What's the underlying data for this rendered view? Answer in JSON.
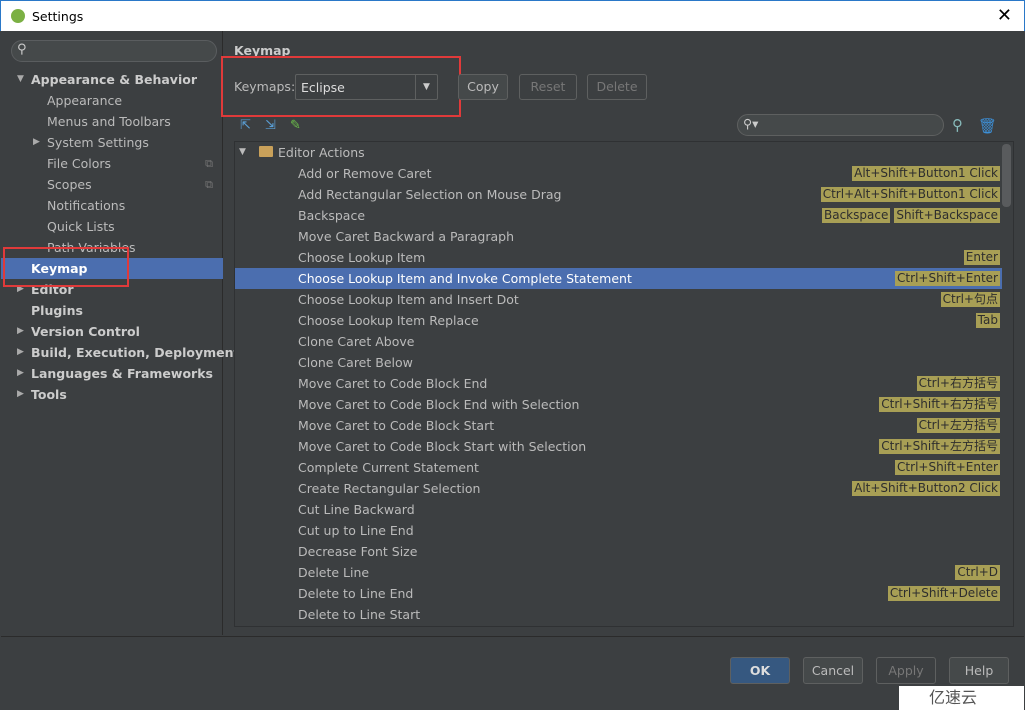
{
  "window": {
    "title": "Settings",
    "close": "✕"
  },
  "sidebar": {
    "search_icon": "search-icon",
    "items": [
      {
        "label": "Appearance & Behavior",
        "level": 0,
        "bold": true,
        "expanded": true
      },
      {
        "label": "Appearance",
        "level": 1
      },
      {
        "label": "Menus and Toolbars",
        "level": 1
      },
      {
        "label": "System Settings",
        "level": 1,
        "collapsed": true
      },
      {
        "label": "File Colors",
        "level": 1,
        "project": true
      },
      {
        "label": "Scopes",
        "level": 1,
        "project": true
      },
      {
        "label": "Notifications",
        "level": 1
      },
      {
        "label": "Quick Lists",
        "level": 1
      },
      {
        "label": "Path Variables",
        "level": 1
      },
      {
        "label": "Keymap",
        "level": 0,
        "bold": true,
        "selected": true
      },
      {
        "label": "Editor",
        "level": 0,
        "bold": true,
        "collapsed": true
      },
      {
        "label": "Plugins",
        "level": 0,
        "bold": true
      },
      {
        "label": "Version Control",
        "level": 0,
        "bold": true,
        "collapsed": true
      },
      {
        "label": "Build, Execution, Deployment",
        "level": 0,
        "bold": true,
        "collapsed": true
      },
      {
        "label": "Languages & Frameworks",
        "level": 0,
        "bold": true,
        "collapsed": true
      },
      {
        "label": "Tools",
        "level": 0,
        "bold": true,
        "collapsed": true
      }
    ]
  },
  "main": {
    "title": "Keymap",
    "keymaps_label": "Keymaps:",
    "keymap_value": "Eclipse",
    "copy": "Copy",
    "reset": "Reset",
    "delete": "Delete",
    "group": "Editor Actions",
    "rows": [
      {
        "label": "Add or Remove Caret",
        "keys": [
          "Alt+Shift+Button1 Click"
        ]
      },
      {
        "label": "Add Rectangular Selection on Mouse Drag",
        "keys": [
          "Ctrl+Alt+Shift+Button1 Click"
        ]
      },
      {
        "label": "Backspace",
        "keys": [
          "Backspace",
          "Shift+Backspace"
        ]
      },
      {
        "label": "Move Caret Backward a Paragraph",
        "keys": []
      },
      {
        "label": "Choose Lookup Item",
        "keys": [
          "Enter"
        ]
      },
      {
        "label": "Choose Lookup Item and Invoke Complete Statement",
        "keys": [
          "Ctrl+Shift+Enter"
        ],
        "selected": true
      },
      {
        "label": "Choose Lookup Item and Insert Dot",
        "keys": [
          "Ctrl+句点"
        ]
      },
      {
        "label": "Choose Lookup Item Replace",
        "keys": [
          "Tab"
        ]
      },
      {
        "label": "Clone Caret Above",
        "keys": []
      },
      {
        "label": "Clone Caret Below",
        "keys": []
      },
      {
        "label": "Move Caret to Code Block End",
        "keys": [
          "Ctrl+右方括号"
        ]
      },
      {
        "label": "Move Caret to Code Block End with Selection",
        "keys": [
          "Ctrl+Shift+右方括号"
        ]
      },
      {
        "label": "Move Caret to Code Block Start",
        "keys": [
          "Ctrl+左方括号"
        ]
      },
      {
        "label": "Move Caret to Code Block Start with Selection",
        "keys": [
          "Ctrl+Shift+左方括号"
        ]
      },
      {
        "label": "Complete Current Statement",
        "keys": [
          "Ctrl+Shift+Enter"
        ]
      },
      {
        "label": "Create Rectangular Selection",
        "keys": [
          "Alt+Shift+Button2 Click"
        ]
      },
      {
        "label": "Cut Line Backward",
        "keys": []
      },
      {
        "label": "Cut up to Line End",
        "keys": []
      },
      {
        "label": "Decrease Font Size",
        "keys": []
      },
      {
        "label": "Delete Line",
        "keys": [
          "Ctrl+D"
        ]
      },
      {
        "label": "Delete to Line End",
        "keys": [
          "Ctrl+Shift+Delete"
        ]
      },
      {
        "label": "Delete to Line Start",
        "keys": []
      }
    ]
  },
  "footer": {
    "ok": "OK",
    "cancel": "Cancel",
    "apply": "Apply",
    "help": "Help"
  },
  "watermark": "亿速云",
  "colors": {
    "selection": "#4b6eaf",
    "shortcut_bg": "#a89f55",
    "highlight": "#e03a3a"
  }
}
